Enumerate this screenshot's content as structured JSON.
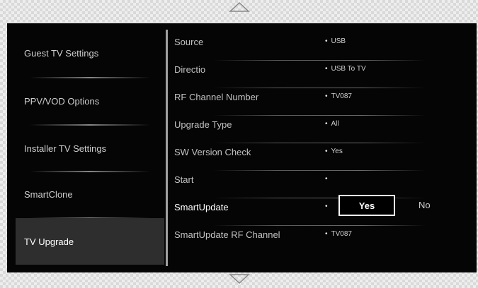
{
  "left_menu": [
    {
      "label": "Guest TV Settings",
      "selected": false
    },
    {
      "label": "PPV/VOD Options",
      "selected": false
    },
    {
      "label": "Installer TV Settings",
      "selected": false
    },
    {
      "label": "SmartClone",
      "selected": false
    },
    {
      "label": "TV Upgrade",
      "selected": true
    }
  ],
  "settings": [
    {
      "label": "Source",
      "value": "USB"
    },
    {
      "label": "Directio",
      "value": "USB To TV"
    },
    {
      "label": "RF Channel Number",
      "value": "TV087"
    },
    {
      "label": "Upgrade Type",
      "value": "All"
    },
    {
      "label": "SW Version Check",
      "value": "Yes"
    },
    {
      "label": "Start",
      "value": ""
    },
    {
      "label": "SmartUpdate",
      "value": ""
    },
    {
      "label": "SmartUpdate RF Channel",
      "value": "TV087"
    }
  ],
  "smartupdate_options": {
    "yes": "Yes",
    "no": "No"
  },
  "bullet": "•",
  "icons": {
    "scroll_up": "triangle-up-icon",
    "scroll_down": "triangle-down-icon"
  },
  "colors": {
    "panel_bg": "#050505",
    "selected_bg": "#2e2e2e",
    "text": "#cfcfcf"
  }
}
